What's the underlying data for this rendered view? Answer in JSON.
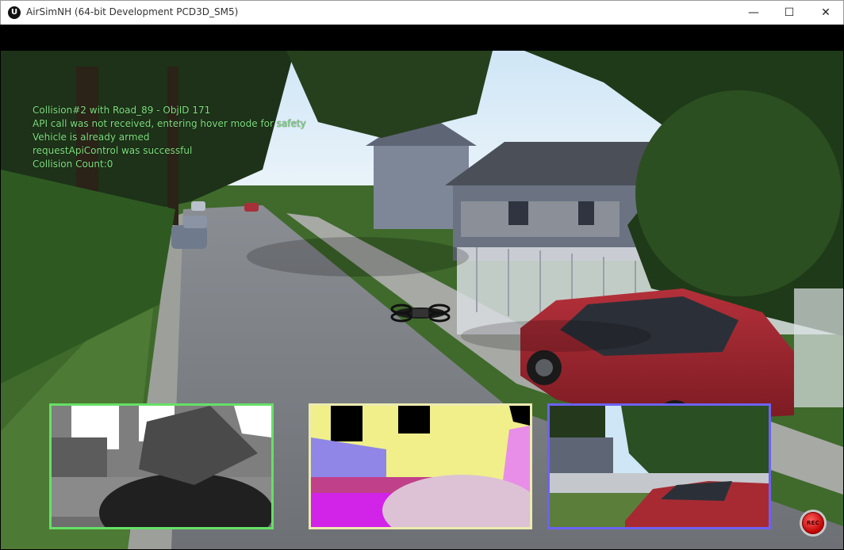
{
  "window": {
    "title": "AirSimNH (64-bit Development PCD3D_SM5)",
    "logo_glyph": "U",
    "minimize_glyph": "—",
    "maximize_glyph": "☐",
    "close_glyph": "✕"
  },
  "hud": {
    "lines": [
      "Collision#2 with Road_89 - ObjID 171",
      "API call was not received, entering hover mode for safety",
      "Vehicle is already armed",
      "requestApiControl was successful",
      "Collision Count:0"
    ]
  },
  "subwindows": [
    {
      "name": "Depth view",
      "border_color": "#66e066"
    },
    {
      "name": "Segmentation view",
      "border_color": "#ecebb0"
    },
    {
      "name": "Scene view",
      "border_color": "#6c62f2"
    }
  ],
  "record_button": {
    "label": "REC"
  },
  "colors": {
    "hud_text": "#7fe07f",
    "record": "#d00000"
  }
}
